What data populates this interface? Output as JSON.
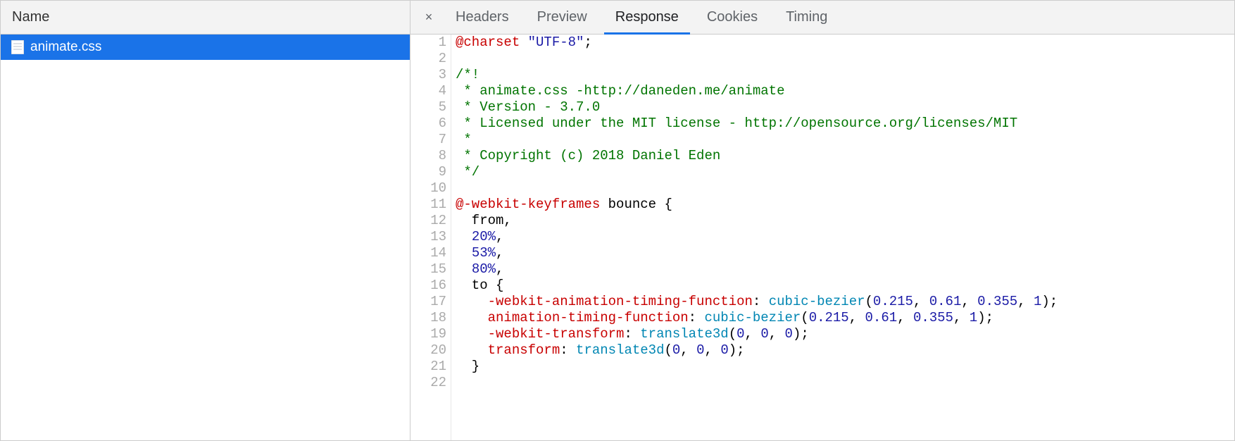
{
  "leftPane": {
    "header": "Name",
    "files": [
      {
        "name": "animate.css",
        "selected": true
      }
    ]
  },
  "tabs": {
    "items": [
      "Headers",
      "Preview",
      "Response",
      "Cookies",
      "Timing"
    ],
    "active": "Response",
    "closeGlyph": "×"
  },
  "code": {
    "lines": [
      {
        "n": 1,
        "tokens": [
          {
            "t": "@charset",
            "c": "at"
          },
          {
            "t": " "
          },
          {
            "t": "\"UTF-8\"",
            "c": "str"
          },
          {
            "t": ";"
          }
        ]
      },
      {
        "n": 2,
        "tokens": []
      },
      {
        "n": 3,
        "tokens": [
          {
            "t": "/*!",
            "c": "comment"
          }
        ]
      },
      {
        "n": 4,
        "tokens": [
          {
            "t": " * animate.css -http://daneden.me/animate",
            "c": "comment"
          }
        ]
      },
      {
        "n": 5,
        "tokens": [
          {
            "t": " * Version - 3.7.0",
            "c": "comment"
          }
        ]
      },
      {
        "n": 6,
        "tokens": [
          {
            "t": " * Licensed under the MIT license - http://opensource.org/licenses/MIT",
            "c": "comment"
          }
        ]
      },
      {
        "n": 7,
        "tokens": [
          {
            "t": " *",
            "c": "comment"
          }
        ]
      },
      {
        "n": 8,
        "tokens": [
          {
            "t": " * Copyright (c) 2018 Daniel Eden",
            "c": "comment"
          }
        ]
      },
      {
        "n": 9,
        "tokens": [
          {
            "t": " */",
            "c": "comment"
          }
        ]
      },
      {
        "n": 10,
        "tokens": []
      },
      {
        "n": 11,
        "tokens": [
          {
            "t": "@-webkit-keyframes",
            "c": "at"
          },
          {
            "t": " bounce {"
          }
        ]
      },
      {
        "n": 12,
        "tokens": [
          {
            "t": "  from,"
          }
        ]
      },
      {
        "n": 13,
        "tokens": [
          {
            "t": "  "
          },
          {
            "t": "20%",
            "c": "num"
          },
          {
            "t": ","
          }
        ]
      },
      {
        "n": 14,
        "tokens": [
          {
            "t": "  "
          },
          {
            "t": "53%",
            "c": "num"
          },
          {
            "t": ","
          }
        ]
      },
      {
        "n": 15,
        "tokens": [
          {
            "t": "  "
          },
          {
            "t": "80%",
            "c": "num"
          },
          {
            "t": ","
          }
        ]
      },
      {
        "n": 16,
        "tokens": [
          {
            "t": "  to {"
          }
        ]
      },
      {
        "n": 17,
        "tokens": [
          {
            "t": "    "
          },
          {
            "t": "-webkit-animation-timing-function",
            "c": "prop"
          },
          {
            "t": ": "
          },
          {
            "t": "cubic-bezier",
            "c": "func"
          },
          {
            "t": "("
          },
          {
            "t": "0.215",
            "c": "num"
          },
          {
            "t": ", "
          },
          {
            "t": "0.61",
            "c": "num"
          },
          {
            "t": ", "
          },
          {
            "t": "0.355",
            "c": "num"
          },
          {
            "t": ", "
          },
          {
            "t": "1",
            "c": "num"
          },
          {
            "t": ");"
          }
        ]
      },
      {
        "n": 18,
        "tokens": [
          {
            "t": "    "
          },
          {
            "t": "animation-timing-function",
            "c": "prop"
          },
          {
            "t": ": "
          },
          {
            "t": "cubic-bezier",
            "c": "func"
          },
          {
            "t": "("
          },
          {
            "t": "0.215",
            "c": "num"
          },
          {
            "t": ", "
          },
          {
            "t": "0.61",
            "c": "num"
          },
          {
            "t": ", "
          },
          {
            "t": "0.355",
            "c": "num"
          },
          {
            "t": ", "
          },
          {
            "t": "1",
            "c": "num"
          },
          {
            "t": ");"
          }
        ]
      },
      {
        "n": 19,
        "tokens": [
          {
            "t": "    "
          },
          {
            "t": "-webkit-transform",
            "c": "prop"
          },
          {
            "t": ": "
          },
          {
            "t": "translate3d",
            "c": "func"
          },
          {
            "t": "("
          },
          {
            "t": "0",
            "c": "num"
          },
          {
            "t": ", "
          },
          {
            "t": "0",
            "c": "num"
          },
          {
            "t": ", "
          },
          {
            "t": "0",
            "c": "num"
          },
          {
            "t": ");"
          }
        ]
      },
      {
        "n": 20,
        "tokens": [
          {
            "t": "    "
          },
          {
            "t": "transform",
            "c": "prop"
          },
          {
            "t": ": "
          },
          {
            "t": "translate3d",
            "c": "func"
          },
          {
            "t": "("
          },
          {
            "t": "0",
            "c": "num"
          },
          {
            "t": ", "
          },
          {
            "t": "0",
            "c": "num"
          },
          {
            "t": ", "
          },
          {
            "t": "0",
            "c": "num"
          },
          {
            "t": ");"
          }
        ]
      },
      {
        "n": 21,
        "tokens": [
          {
            "t": "  }"
          }
        ]
      },
      {
        "n": 22,
        "tokens": []
      }
    ]
  }
}
